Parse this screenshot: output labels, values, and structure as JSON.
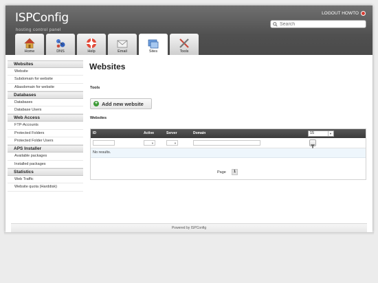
{
  "header": {
    "logo": "ISPConfig",
    "tagline": "hosting control panel",
    "logout_label": "LOGOUT HOWTO",
    "search_placeholder": "Search"
  },
  "tabs": [
    {
      "label": "Home",
      "icon": "home-icon"
    },
    {
      "label": "DNS",
      "icon": "dns-icon"
    },
    {
      "label": "Help",
      "icon": "help-icon"
    },
    {
      "label": "Email",
      "icon": "email-icon"
    },
    {
      "label": "Sites",
      "icon": "sites-icon",
      "active": true
    },
    {
      "label": "Tools",
      "icon": "tools-icon"
    }
  ],
  "sidebar": {
    "sections": [
      {
        "title": "Websites",
        "items": [
          "Website",
          "Subdomain for website",
          "Aliasdomain for website"
        ]
      },
      {
        "title": "Databases",
        "items": [
          "Databases",
          "Database Users"
        ]
      },
      {
        "title": "Web Access",
        "items": [
          "FTP-Accounts",
          "Protected Folders",
          "Protected Folder Users"
        ]
      },
      {
        "title": "APS Installer",
        "items": [
          "Available packages",
          "Installed packages"
        ]
      },
      {
        "title": "Statistics",
        "items": [
          "Web Traffic",
          "Website quota (Harddisk)"
        ]
      }
    ]
  },
  "main": {
    "title": "Websites",
    "tools_label": "Tools",
    "add_button": "Add new website",
    "list_label": "Websites",
    "columns": [
      "ID",
      "Active",
      "Server",
      "Domain"
    ],
    "limit_value": "15",
    "no_results": "No results.",
    "page_label": "Page",
    "page_number": "1"
  },
  "footer": {
    "text": "Powered by ISPConfig"
  }
}
